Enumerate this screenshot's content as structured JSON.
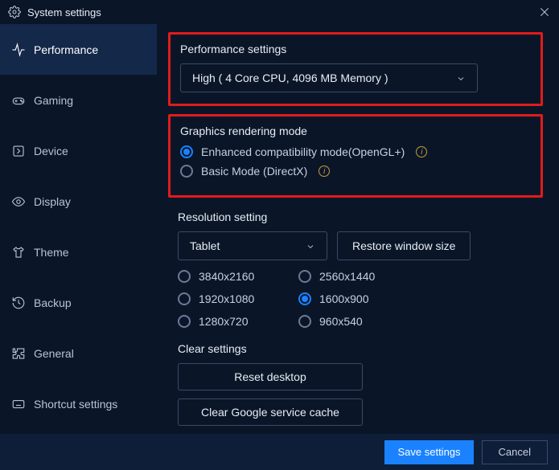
{
  "window": {
    "title": "System settings"
  },
  "sidebar": {
    "items": [
      {
        "label": "Performance",
        "icon": "activity-icon",
        "active": true
      },
      {
        "label": "Gaming",
        "icon": "gamepad-icon",
        "active": false
      },
      {
        "label": "Device",
        "icon": "arrow-right-square-icon",
        "active": false
      },
      {
        "label": "Display",
        "icon": "eye-icon",
        "active": false
      },
      {
        "label": "Theme",
        "icon": "tshirt-icon",
        "active": false
      },
      {
        "label": "Backup",
        "icon": "history-icon",
        "active": false
      },
      {
        "label": "General",
        "icon": "puzzle-icon",
        "active": false
      },
      {
        "label": "Shortcut settings",
        "icon": "keyboard-icon",
        "active": false
      }
    ]
  },
  "performance_settings": {
    "title": "Performance settings",
    "selected": "High ( 4 Core CPU, 4096 MB Memory )"
  },
  "graphics_mode": {
    "title": "Graphics rendering mode",
    "options": [
      {
        "label": "Enhanced compatibility mode(OpenGL+)",
        "selected": true,
        "info": true
      },
      {
        "label": "Basic Mode (DirectX)",
        "selected": false,
        "info": true
      }
    ]
  },
  "resolution": {
    "title": "Resolution setting",
    "mode_selected": "Tablet",
    "restore_label": "Restore window size",
    "options": [
      {
        "label": "3840x2160",
        "selected": false
      },
      {
        "label": "2560x1440",
        "selected": false
      },
      {
        "label": "1920x1080",
        "selected": false
      },
      {
        "label": "1600x900",
        "selected": true
      },
      {
        "label": "1280x720",
        "selected": false
      },
      {
        "label": "960x540",
        "selected": false
      }
    ]
  },
  "clear": {
    "title": "Clear settings",
    "reset_label": "Reset desktop",
    "cache_label": "Clear Google service cache"
  },
  "footer": {
    "save": "Save settings",
    "cancel": "Cancel"
  }
}
